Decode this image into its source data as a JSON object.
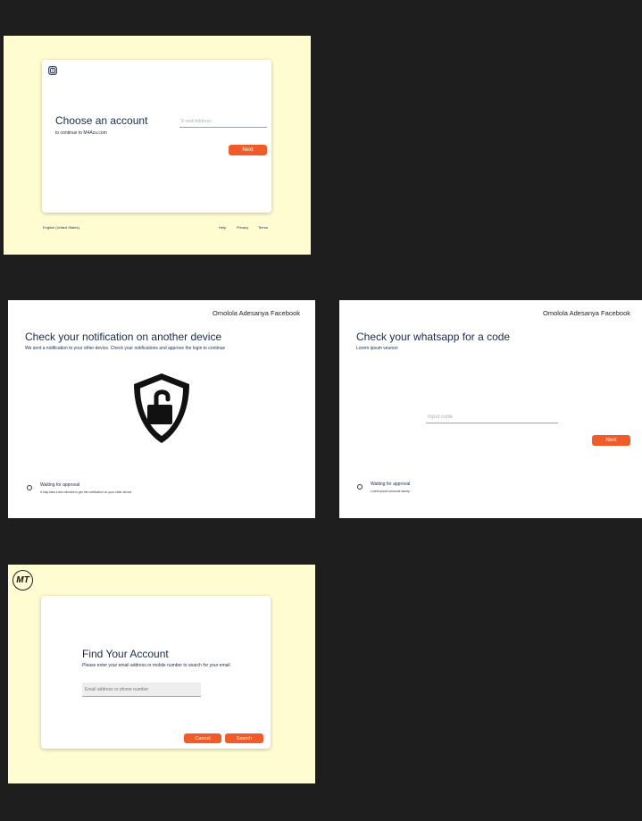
{
  "screen1": {
    "logo_label": "logo",
    "title": "Choose an account",
    "subtitle": "to continue to M4Acu.com",
    "email_placeholder": "E-mail Address",
    "next_label": "Next",
    "footer_language": "English (United States)",
    "footer_links": [
      "Help",
      "Privacy",
      "Terms"
    ]
  },
  "screen2": {
    "header_name": "Omolola Adesanya Facebook",
    "title": "Check your notification on another device",
    "subtitle": "We sent a notification to your other device. Check your notifications and approve the login to continue",
    "status_title": "Waiting for approval",
    "status_detail": "It may take a few minutes to get the notification on your other device"
  },
  "screen3": {
    "header_name": "Omolola Adesanya Facebook",
    "title": "Check your whatsapp for a code",
    "subtitle": "Lorem ipsum veunon",
    "code_placeholder": "Input code",
    "next_label": "Next",
    "status_title": "Waiting for approval",
    "status_detail": "Lorem ipsum veunone amerp"
  },
  "screen4": {
    "logo_text": "MT",
    "title": "Find Your Account",
    "instructions": "Please enter your email address or mobile number to search for your email",
    "input_placeholder": "Email address or phone number",
    "cancel_label": "Cancel",
    "search_label": "Search"
  },
  "colors": {
    "background": "#1e1e1e",
    "cream": "#fffcd2",
    "accent": "#f15a29",
    "text": "#1a2b4a"
  },
  "icons": {
    "shield": "unlocked-shield-icon",
    "screen1_logo": "grid-logo-icon"
  }
}
